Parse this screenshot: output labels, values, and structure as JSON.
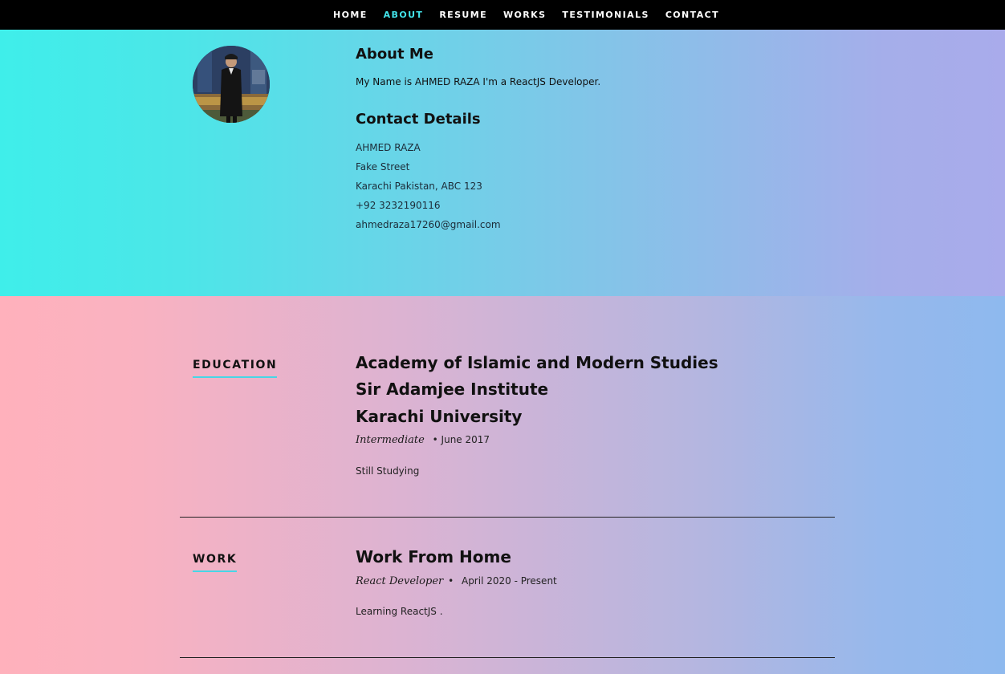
{
  "nav": {
    "items": [
      "HOME",
      "ABOUT",
      "RESUME",
      "WORKS",
      "TESTIMONIALS",
      "CONTACT"
    ],
    "active_color": "#43e3ea"
  },
  "about": {
    "title": "About Me",
    "text": "My Name is AHMED RAZA I'm a ReactJS Developer.",
    "contact_title": "Contact Details",
    "contact": {
      "name": "AHMED RAZA",
      "street": "Fake Street",
      "city": "Karachi Pakistan, ABC 123",
      "phone": "+92 3232190116",
      "email": "ahmedraza17260@gmail.com"
    }
  },
  "education": {
    "label": "EDUCATION",
    "schools": [
      "Academy of Islamic and Modern Studies",
      "Sir Adamjee Institute",
      "Karachi University"
    ],
    "degree": "Intermediate",
    "bullet": "•",
    "date": "June 2017",
    "description": "Still Studying"
  },
  "work": {
    "label": "WORK",
    "company": "Work From Home",
    "role": "React Developer",
    "bullet": "•",
    "date": "April 2020 - Present",
    "description": "Learning ReactJS ."
  },
  "colors": {
    "nav_bg": "#000000",
    "accent": "#43e3ea",
    "about_gradient": [
      "#3feeea",
      "#a9abeb"
    ],
    "resume_gradient": [
      "#ffb1bc",
      "#8eb9ee"
    ]
  }
}
